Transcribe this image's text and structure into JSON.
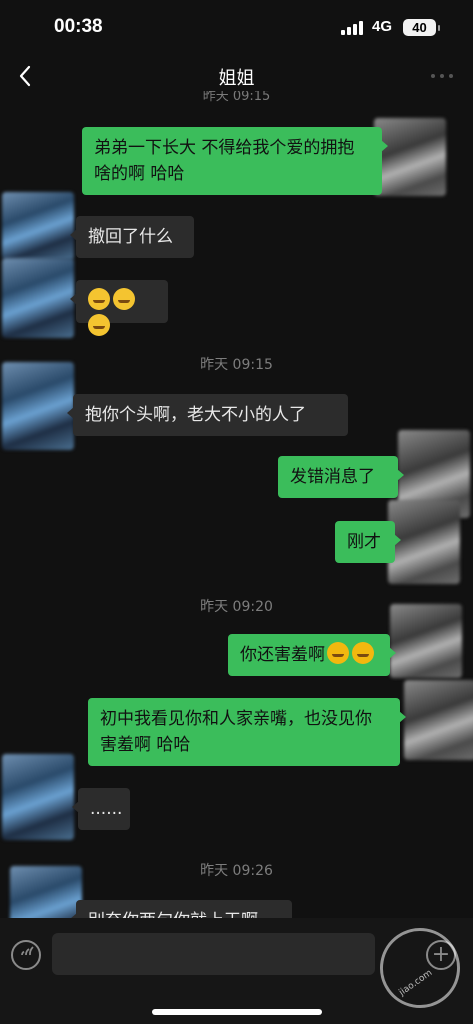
{
  "status_bar": {
    "time": "00:38",
    "network": "4G",
    "battery": "40"
  },
  "header": {
    "title": "姐姐",
    "back_icon": "chevron-left-icon",
    "more_icon": "more-dots-icon"
  },
  "messages": [
    {
      "from": "me",
      "text": "弟弟一下长大 不得给我个爱的拥抱啥的啊 哈哈"
    },
    {
      "from": "other",
      "text": "撤回了什么"
    },
    {
      "from": "other",
      "emoji": [
        "dizzy-face",
        "dizzy-face",
        "dizzy-face"
      ]
    },
    {
      "time": "昨天 09:15"
    },
    {
      "from": "other",
      "text": "抱你个头啊，老大不小的人了"
    },
    {
      "from": "me",
      "text": "发错消息了"
    },
    {
      "from": "me",
      "text": "刚才"
    },
    {
      "time": "昨天 09:20"
    },
    {
      "from": "me",
      "text": "你还害羞啊",
      "emoji": [
        "tears-of-joy",
        "tears-of-joy"
      ]
    },
    {
      "from": "me",
      "text": "初中我看见你和人家亲嘴，也没见你害羞啊 哈哈"
    },
    {
      "from": "other",
      "text": "......"
    },
    {
      "time": "昨天 09:26"
    },
    {
      "from": "other",
      "text": "别奈你两句你就上天啊"
    }
  ],
  "input_bar": {
    "voice_icon": "voice-icon",
    "plus_icon": "plus-icon",
    "value": ""
  },
  "watermark": {
    "text": "jiao.com"
  }
}
